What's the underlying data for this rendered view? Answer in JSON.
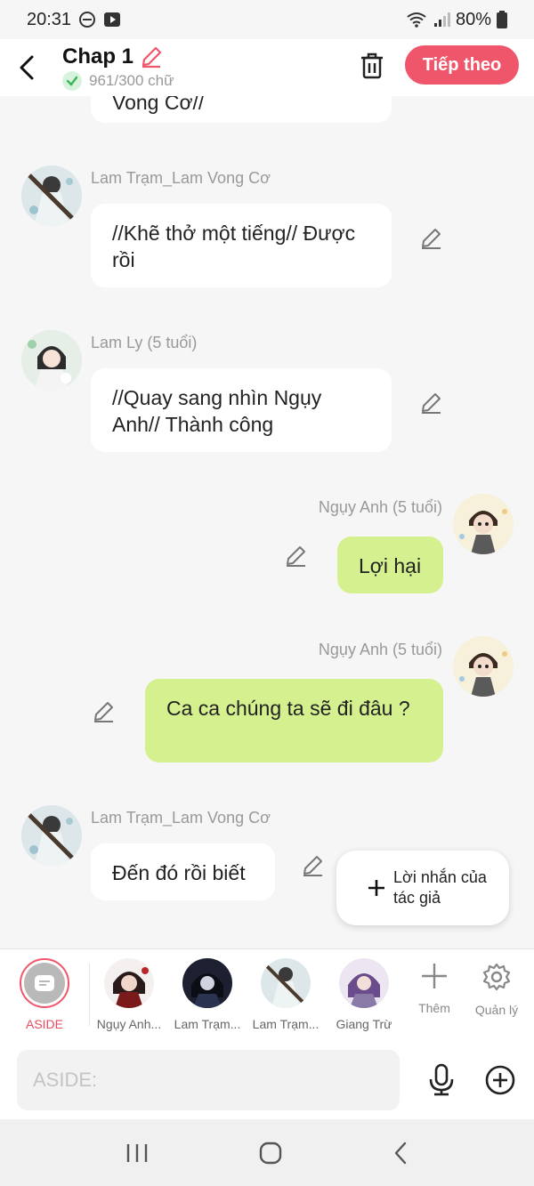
{
  "status": {
    "time": "20:31",
    "battery": "80%"
  },
  "header": {
    "title": "Chap 1",
    "word_count": "961/300 chữ",
    "next_label": "Tiếp theo"
  },
  "chat": {
    "top_fragment": "Vong Cơ//",
    "messages": [
      {
        "side": "left",
        "name": "Lam Trạm_Lam Vong Cơ",
        "text": "//Khẽ thở một tiếng// Được rồi"
      },
      {
        "side": "left",
        "name": "Lam Ly (5 tuổi)",
        "text": "//Quay sang nhìn Ngụy Anh// Thành công"
      },
      {
        "side": "right",
        "name": "Ngụy Anh (5 tuổi)",
        "text": "Lợi hại"
      },
      {
        "side": "right",
        "name": "Ngụy Anh (5 tuổi)",
        "text": "Ca ca chúng ta sẽ đi đâu ?"
      },
      {
        "side": "left",
        "name": "Lam Trạm_Lam Vong Cơ",
        "text": "Đến đó rồi biết"
      }
    ]
  },
  "author_note": {
    "label": "Lời nhắn của tác giả"
  },
  "characters": [
    {
      "label": "ASIDE"
    },
    {
      "label": "Ngụy Anh..."
    },
    {
      "label": "Lam Trạm..."
    },
    {
      "label": "Lam Trạm..."
    },
    {
      "label": "Giang Trừ"
    }
  ],
  "tools": {
    "add_label": "Thêm",
    "manage_label": "Quản lý"
  },
  "input": {
    "placeholder": "ASIDE:"
  },
  "colors": {
    "accent": "#f0566b",
    "right_bubble": "#d5f08e"
  }
}
